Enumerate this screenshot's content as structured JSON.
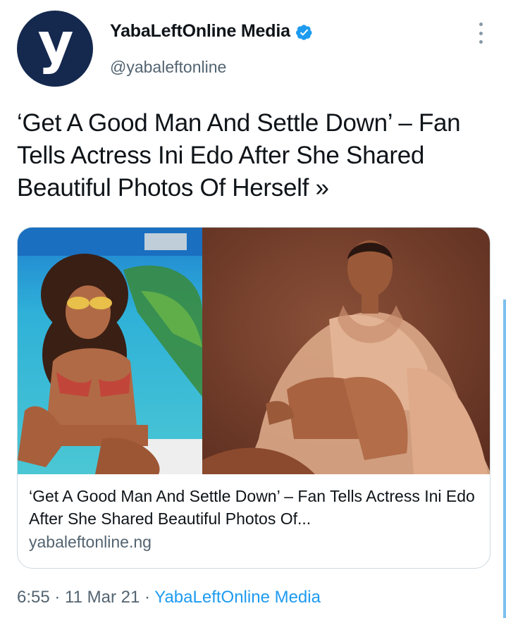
{
  "author": {
    "display_name": "YabaLeftOnline Media",
    "handle": "@yabaleftonline",
    "avatar_letter": "y",
    "verified": true,
    "avatar_color": "#15294f"
  },
  "tweet": {
    "text": "‘Get A Good Man And Settle Down’ – Fan Tells Actress Ini Edo After She Shared Beautiful Photos Of Herself »"
  },
  "link_card": {
    "title": "‘Get A Good Man And Settle Down’ – Fan Tells Actress Ini Edo After She Shared Beautiful Photos Of...",
    "domain": "yabaleftonline.ng"
  },
  "meta": {
    "time": "6:55",
    "separator": " · ",
    "date": "11 Mar 21",
    "source": "YabaLeftOnline Media"
  },
  "icons": {
    "verified": "verified-badge-icon",
    "more": "more-options-icon"
  },
  "colors": {
    "accent": "#1d9bf0",
    "secondary_text": "#536471",
    "verified": "#1d9bf0"
  }
}
